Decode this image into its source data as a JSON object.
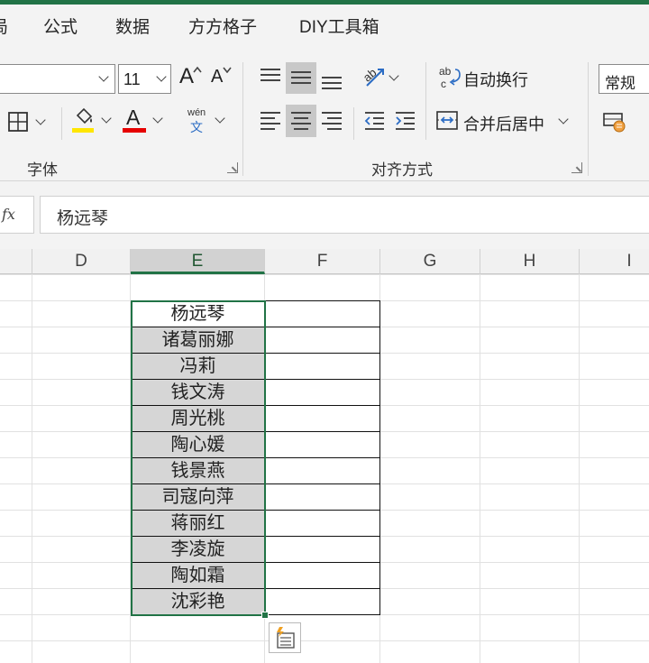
{
  "menu": {
    "partial_tab": "局",
    "tabs": [
      "公式",
      "数据",
      "方方格子",
      "DIY工具箱"
    ]
  },
  "ribbon": {
    "font_size": "11",
    "grow_font": "A",
    "shrink_font": "A",
    "fill_color": "#ffe600",
    "font_color": "#e60000",
    "pinyin_top": "wén",
    "pinyin_bottom": "文",
    "wrap_text": "自动换行",
    "merge_center": "合并后居中",
    "number_format": "常规",
    "font_group": "字体",
    "alignment_group": "对齐方式",
    "accent": "#217346"
  },
  "formula_bar": {
    "fx": "fx",
    "value": "杨远琴"
  },
  "columns": [
    "D",
    "E",
    "F",
    "G",
    "H",
    "I"
  ],
  "selected_column": "E",
  "cells_e": [
    "杨远琴",
    "诸葛丽娜",
    "冯莉",
    "钱文涛",
    "周光桃",
    "陶心媛",
    "钱景燕",
    "司寇向萍",
    "蒋丽红",
    "李凌旋",
    "陶如霜",
    "沈彩艳"
  ]
}
